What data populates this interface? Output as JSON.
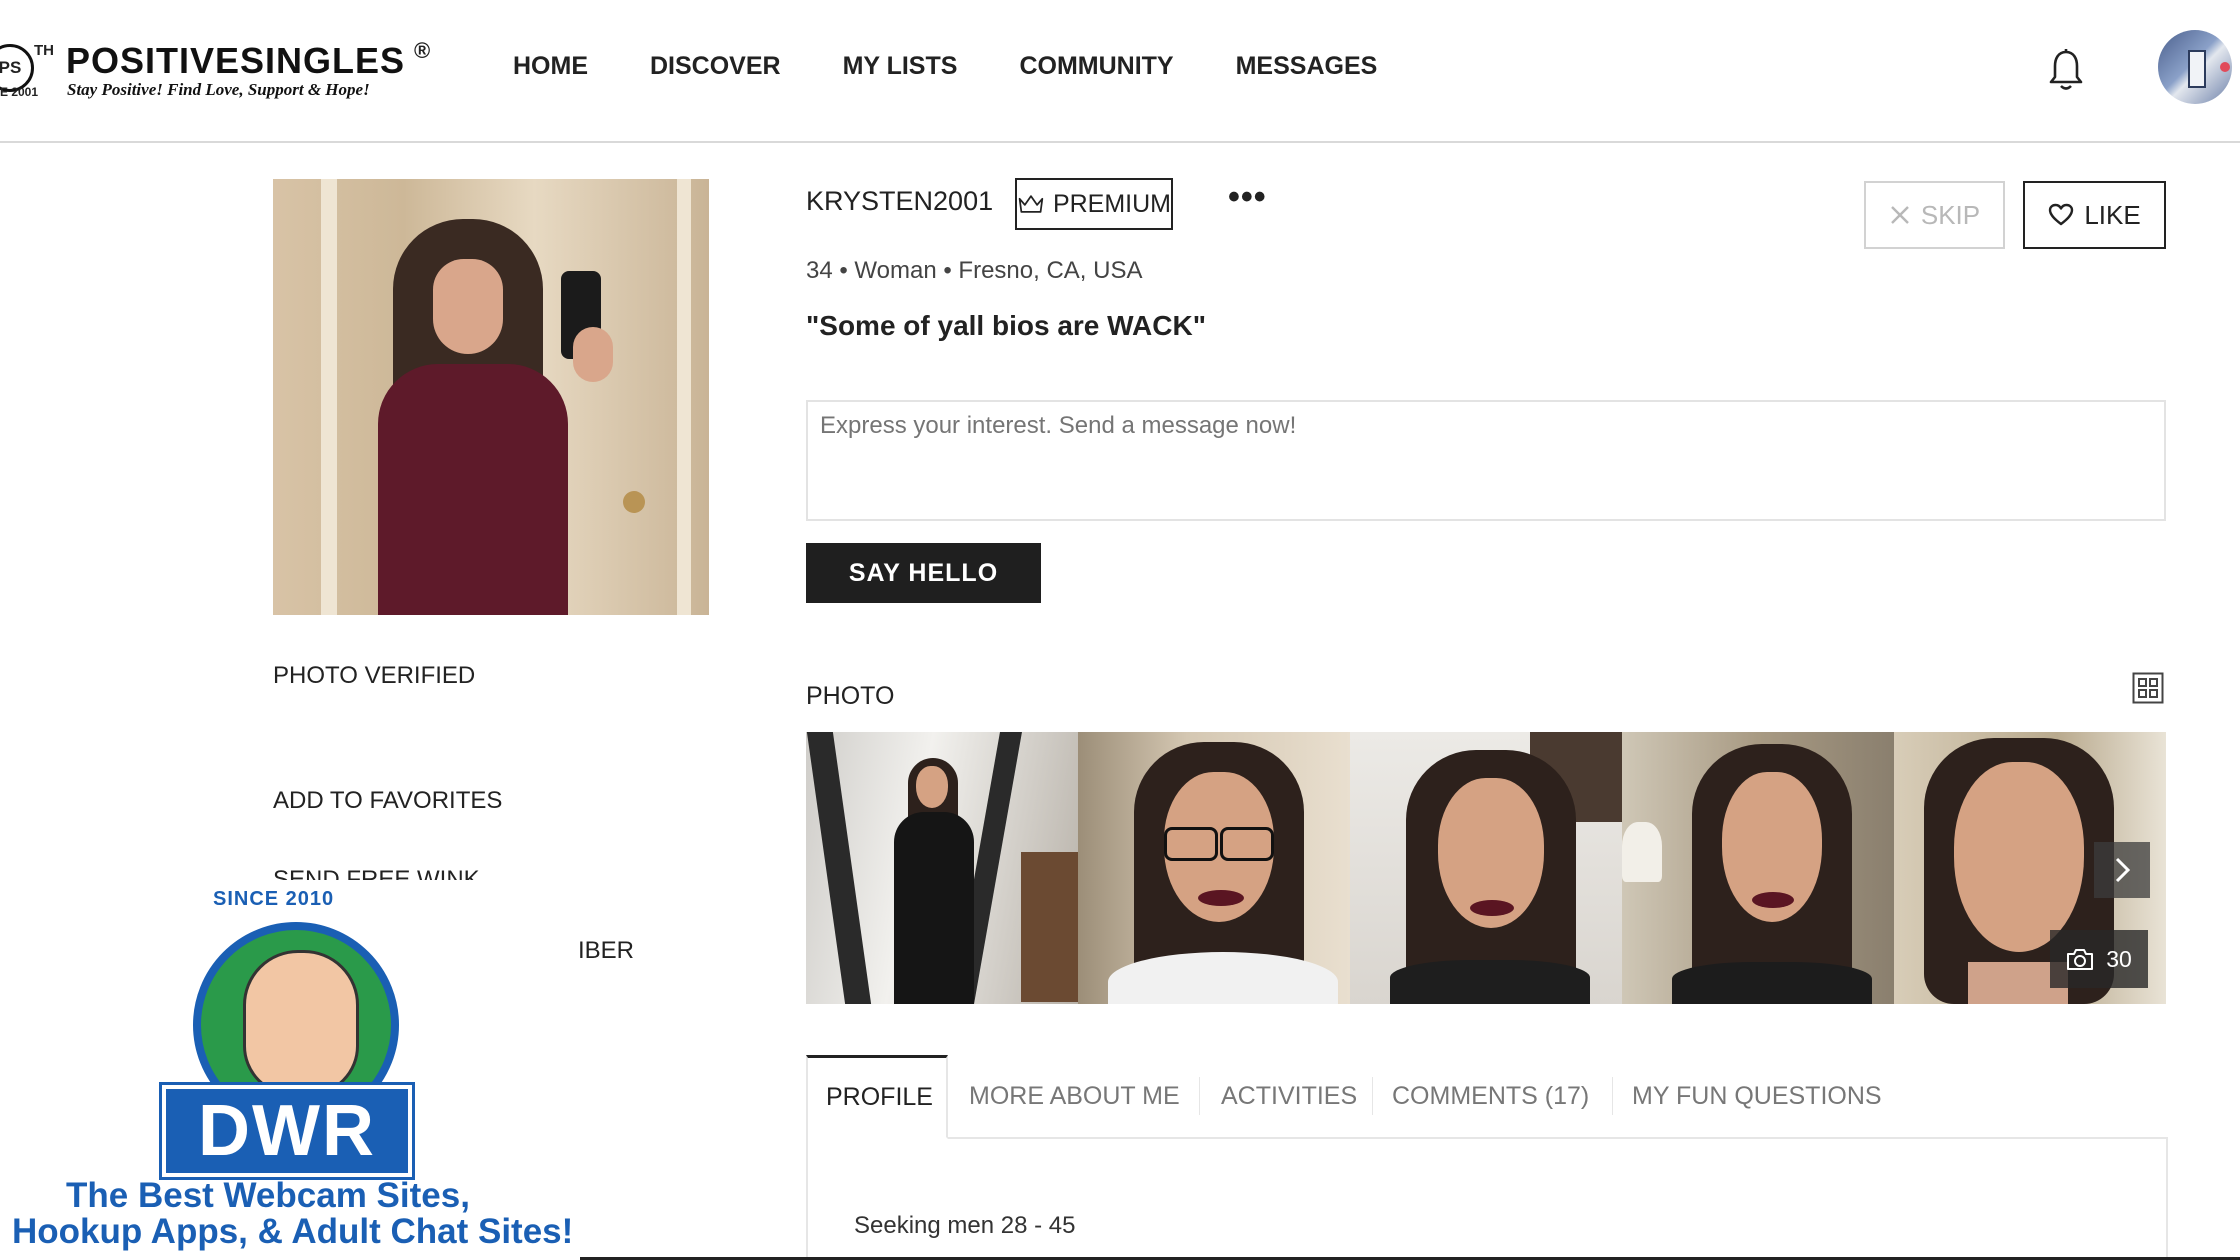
{
  "brand": {
    "name": "POSITIVESINGLES",
    "registered": "®",
    "tagline": "Stay Positive! Find Love, Support & Hope!",
    "badge": "PS",
    "badge_th": "TH",
    "since": "E 2001"
  },
  "nav": {
    "items": [
      "HOME",
      "DISCOVER",
      "MY LISTS",
      "COMMUNITY",
      "MESSAGES"
    ]
  },
  "header_icons": {
    "notifications": "bell-icon",
    "profile": "avatar"
  },
  "sidebar": {
    "photo_verified": "PHOTO VERIFIED",
    "add_to_favorites": "ADD TO FAVORITES",
    "send_free_wink": "SEND FREE WINK",
    "member_partial": "IBER"
  },
  "profile": {
    "username": "KRYSTEN2001",
    "premium_label": "PREMIUM",
    "more_label": "•••",
    "info": "34 • Woman • Fresno, CA, USA",
    "quote": "\"Some of yall bios are WACK\"",
    "skip_label": "SKIP",
    "like_label": "LIKE"
  },
  "message": {
    "placeholder": "Express your interest. Send a message now!",
    "button": "SAY HELLO"
  },
  "photos": {
    "label": "PHOTO",
    "count": "30",
    "icons": [
      "grid-icon",
      "chevron-right-icon",
      "camera-icon"
    ]
  },
  "tabs": {
    "items": [
      "PROFILE",
      "MORE ABOUT ME",
      "ACTIVITIES",
      "COMMENTS (17)",
      "MY FUN QUESTIONS"
    ],
    "active": "PROFILE"
  },
  "profile_tab": {
    "seeking": "Seeking men 28 - 45"
  },
  "ad": {
    "since": "SINCE 2010",
    "logo": "DWR",
    "line1": "The Best Webcam Sites,",
    "line2": "Hookup Apps, & Adult Chat Sites!"
  },
  "colors": {
    "text": "#222222",
    "button_dark": "#1f1f1f",
    "border": "#e3e3e3",
    "ad_blue": "#1a5fb4",
    "ad_green": "#2a9a4a"
  }
}
